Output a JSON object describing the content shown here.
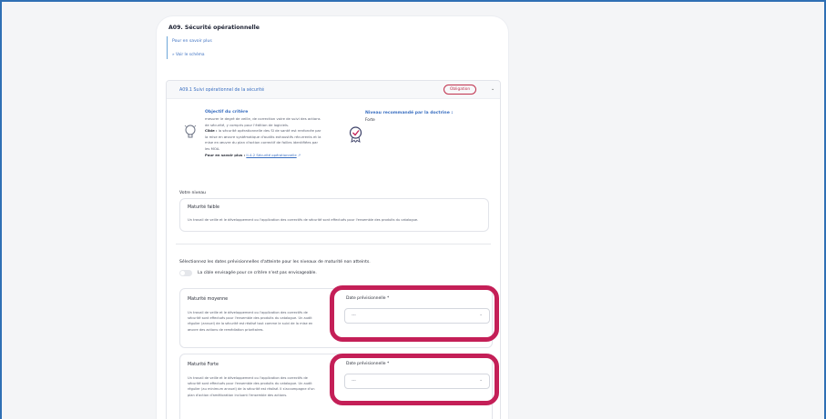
{
  "page": {
    "title": "A09. Sécurité opérationnelle",
    "link_more": "Pour en savoir plus",
    "link_schema": "» Voir le schéma"
  },
  "criterion": {
    "title": "A09.1 Suivi opérationnel de la sécurité",
    "badge": "Obligation",
    "objective_title": "Objectif du critère",
    "objective_text": "mesurer le degré de veille, de correction voire de suivi des actions de sécurité, y compris pour l'édition de logiciels.",
    "cible_label": "Cible :",
    "cible_text": "la sécurité opérationnelle des SI de santé est renforcée par la mise en œuvre systématique d'audits exhaustifs récurrents et la mise en œuvre du plan d'action correctif de failles identifiées par les MOA.",
    "more_label": "Pour en savoir plus :",
    "more_link": "II-4-2 Sécurité opérationnelle",
    "level_title": "Niveau recommandé par la doctrine :",
    "level_value": "Forte"
  },
  "current": {
    "heading": "Votre niveau",
    "title": "Maturité faible",
    "desc": "Un travail de veille et le développement ou l'application des correctifs de sécurité sont effectués pour l'ensemble des produits du catalogue."
  },
  "targets": {
    "heading": "Sélectionnez les dates prévisionnelles d'atteinte pour les niveaux de maturité non atteints.",
    "toggle_label": "La cible envisagée pour ce critère n'est pas envisageable.",
    "items": [
      {
        "title": "Maturité moyenne",
        "desc": "Un travail de veille et le développement ou l'application des correctifs de sécurité sont effectués pour l'ensemble des produits du catalogue. Un audit régulier (annuel) de la sécurité est réalisé tout comme le suivi de la mise en œuvre des actions de remédiation prioritaires.",
        "date_label": "Date prévisionnelle *",
        "date_value": "---"
      },
      {
        "title": "Maturité Forte",
        "desc": "Un travail de veille et le développement ou l'application des correctifs de sécurité sont effectués pour l'ensemble des produits du catalogue. Un audit régulier (au minimum annuel) de la sécurité est réalisé. Il s'accompagne d'un plan d'action d'amélioration incluant l'ensemble des actions.",
        "date_label": "Date prévisionnelle *",
        "date_value": "---"
      }
    ]
  },
  "colors": {
    "accent": "#3a6fc1",
    "highlight": "#c41f57",
    "badge": "#c0314d"
  },
  "icons": [
    "bulb-icon",
    "medal-icon",
    "external-link-icon",
    "chevron-down-icon"
  ]
}
